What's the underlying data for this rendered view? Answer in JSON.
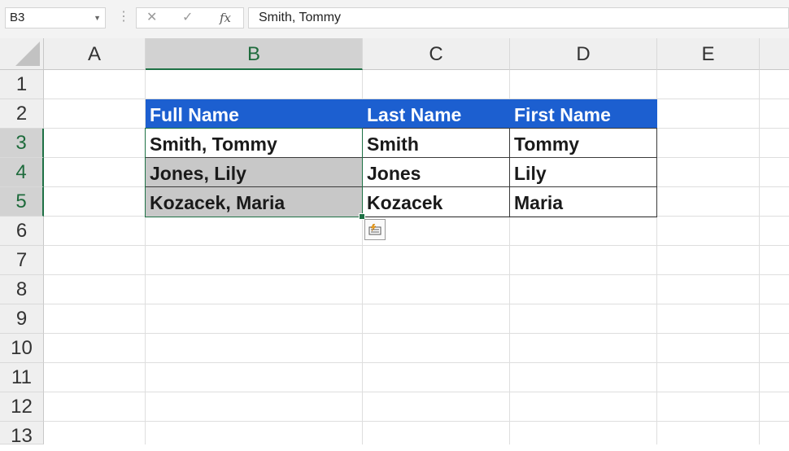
{
  "formula_bar": {
    "name_box": "B3",
    "cancel_symbol": "✕",
    "enter_symbol": "✓",
    "fx_symbol": "fx",
    "formula": "Smith, Tommy"
  },
  "columns": [
    "A",
    "B",
    "C",
    "D",
    "E"
  ],
  "rows": [
    "1",
    "2",
    "3",
    "4",
    "5",
    "6",
    "7",
    "8",
    "9",
    "10",
    "11",
    "12",
    "13"
  ],
  "selected_column": "B",
  "selected_rows": [
    "3",
    "4",
    "5"
  ],
  "table": {
    "header": {
      "full_name": "Full Name",
      "last_name": "Last Name",
      "first_name": "First Name"
    },
    "rows": [
      {
        "full_name": "Smith, Tommy",
        "last_name": "Smith",
        "first_name": "Tommy"
      },
      {
        "full_name": "Jones, Lily",
        "last_name": "Jones",
        "first_name": "Lily"
      },
      {
        "full_name": "Kozacek, Maria",
        "last_name": "Kozacek",
        "first_name": "Maria"
      }
    ]
  },
  "colors": {
    "header_fill": "#1c5fd0",
    "selection_fill": "#c8c8c8",
    "selection_border": "#1e7145"
  },
  "icons": {
    "flash_fill_options": "flash-fill-options-icon"
  }
}
